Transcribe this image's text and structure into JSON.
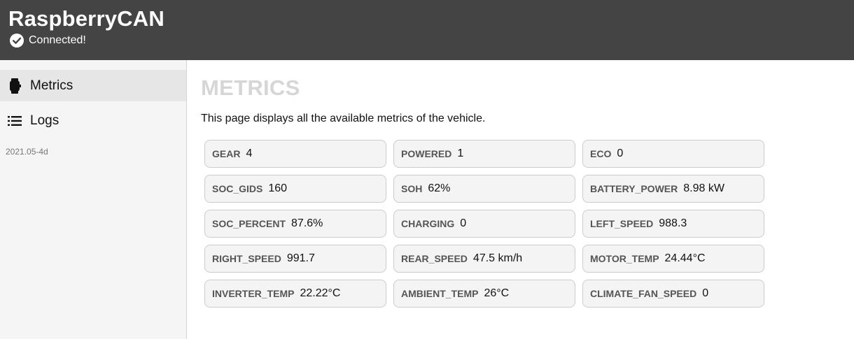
{
  "header": {
    "title": "RaspberryCAN",
    "status": "Connected!"
  },
  "sidebar": {
    "items": [
      {
        "label": "Metrics",
        "icon": "watch-icon",
        "active": true
      },
      {
        "label": "Logs",
        "icon": "list-icon",
        "active": false
      }
    ],
    "version": "2021.05-4d"
  },
  "main": {
    "title": "METRICS",
    "description": "This page displays all the available metrics of the vehicle.",
    "metrics": [
      {
        "name": "GEAR",
        "value": "4"
      },
      {
        "name": "POWERED",
        "value": "1"
      },
      {
        "name": "ECO",
        "value": "0"
      },
      {
        "name": "SOC_GIDS",
        "value": "160"
      },
      {
        "name": "SOH",
        "value": "62%"
      },
      {
        "name": "BATTERY_POWER",
        "value": "8.98 kW"
      },
      {
        "name": "SOC_PERCENT",
        "value": "87.6%"
      },
      {
        "name": "CHARGING",
        "value": "0"
      },
      {
        "name": "LEFT_SPEED",
        "value": "988.3"
      },
      {
        "name": "RIGHT_SPEED",
        "value": "991.7"
      },
      {
        "name": "REAR_SPEED",
        "value": "47.5 km/h"
      },
      {
        "name": "MOTOR_TEMP",
        "value": "24.44°C"
      },
      {
        "name": "INVERTER_TEMP",
        "value": "22.22°C"
      },
      {
        "name": "AMBIENT_TEMP",
        "value": "26°C"
      },
      {
        "name": "CLIMATE_FAN_SPEED",
        "value": "0"
      }
    ]
  },
  "colors": {
    "header_bg": "#444444",
    "sidebar_bg": "#f5f5f5",
    "active_item_bg": "#e6e6e6",
    "title_color": "#d6d6d6",
    "card_bg": "#f4f4f4",
    "card_border": "#cccccc"
  }
}
